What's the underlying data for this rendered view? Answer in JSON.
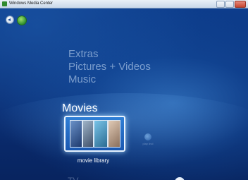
{
  "window": {
    "title": "Windows Media Center"
  },
  "menu": {
    "items": [
      "Extras",
      "Pictures + Videos",
      "Music"
    ],
    "current": "Movies",
    "below": "TV"
  },
  "tiles": [
    {
      "label": "movie library",
      "selected": true
    },
    {
      "label": "play dvd",
      "selected": false
    }
  ],
  "colors": {
    "background": "#0b2a66",
    "highlight": "#e8f3ff",
    "text_dim": "#cde1fa"
  },
  "icons": {
    "back": "back-arrow-icon",
    "logo": "media-center-logo-icon",
    "play": "play-icon"
  }
}
